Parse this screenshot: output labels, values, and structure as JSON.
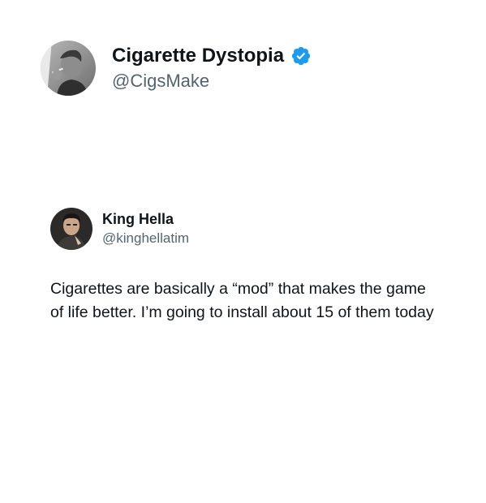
{
  "post": {
    "author": {
      "display_name": "Cigarette Dystopia",
      "handle": "@CigsMake",
      "verified": true,
      "avatar_icon": "avatar-photo-man-smoking",
      "verified_color": "#1d9bf0"
    }
  },
  "quoted_post": {
    "author": {
      "display_name": "King Hella",
      "handle": "@kinghellatim",
      "avatar_icon": "avatar-photo-man-portrait"
    },
    "text": "Cigarettes are basically a “mod” that makes the game of life better. I’m going to install about 15 of them today"
  }
}
